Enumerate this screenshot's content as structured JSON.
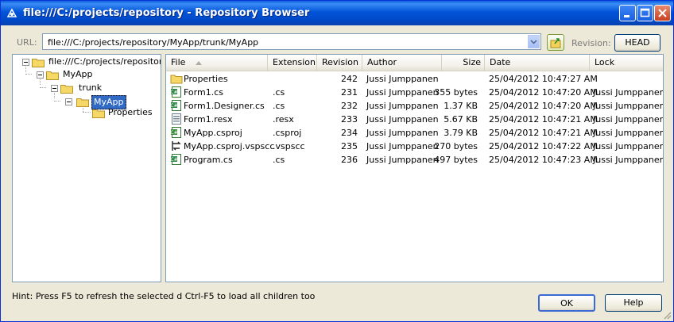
{
  "window": {
    "title": "file:///C:/projects/repository - Repository Browser"
  },
  "toolbar": {
    "url_label": "URL:",
    "url_value": "file:///C:/projects/repository/MyApp/trunk/MyApp",
    "revision_label": "Revision:",
    "revision_button": "HEAD"
  },
  "tree": {
    "nodes": [
      {
        "label": "file:///C:/projects/repository",
        "expanded": true
      },
      {
        "label": "MyApp",
        "expanded": true
      },
      {
        "label": "trunk",
        "expanded": true
      },
      {
        "label": "MyApp",
        "expanded": true,
        "selected": true
      },
      {
        "label": "Properties"
      }
    ]
  },
  "list": {
    "columns": [
      "File",
      "Extension",
      "Revision",
      "Author",
      "Size",
      "Date",
      "Lock"
    ],
    "rows": [
      {
        "icon": "folder-icon",
        "file": "Properties",
        "ext": "",
        "rev": "242",
        "author": "Jussi Jumppanen",
        "size": "",
        "date": "25/04/2012 10:47:27 AM",
        "lock": ""
      },
      {
        "icon": "csharp-file-icon",
        "file": "Form1.cs",
        "ext": ".cs",
        "rev": "231",
        "author": "Jussi Jumppanen",
        "size": "355 bytes",
        "date": "25/04/2012 10:47:20 AM",
        "lock": "Jussi Jumppanen"
      },
      {
        "icon": "csharp-file-icon",
        "file": "Form1.Designer.cs",
        "ext": ".cs",
        "rev": "232",
        "author": "Jussi Jumppanen",
        "size": "1.37 KB",
        "date": "25/04/2012 10:47:20 AM",
        "lock": "Jussi Jumppanen"
      },
      {
        "icon": "resx-file-icon",
        "file": "Form1.resx",
        "ext": ".resx",
        "rev": "233",
        "author": "Jussi Jumppanen",
        "size": "5.67 KB",
        "date": "25/04/2012 10:47:21 AM",
        "lock": "Jussi Jumppanen"
      },
      {
        "icon": "csproj-file-icon",
        "file": "MyApp.csproj",
        "ext": ".csproj",
        "rev": "234",
        "author": "Jussi Jumppanen",
        "size": "3.79 KB",
        "date": "25/04/2012 10:47:21 AM",
        "lock": "Jussi Jumppanen"
      },
      {
        "icon": "vspscc-file-icon",
        "file": "MyApp.csproj.vspscc",
        "ext": ".vspscc",
        "rev": "235",
        "author": "Jussi Jumppanen",
        "size": "270 bytes",
        "date": "25/04/2012 10:47:22 AM",
        "lock": "Jussi Jumppanen"
      },
      {
        "icon": "csharp-file-icon",
        "file": "Program.cs",
        "ext": ".cs",
        "rev": "236",
        "author": "Jussi Jumppanen",
        "size": "497 bytes",
        "date": "25/04/2012 10:47:23 AM",
        "lock": "Jussi Jumppanen"
      }
    ]
  },
  "watermark": {
    "text": "file"
  },
  "footer": {
    "hint": "Hint: Press F5 to refresh the selected d Ctrl-F5 to load all children too",
    "ok_label": "OK",
    "help_label": "Help"
  }
}
